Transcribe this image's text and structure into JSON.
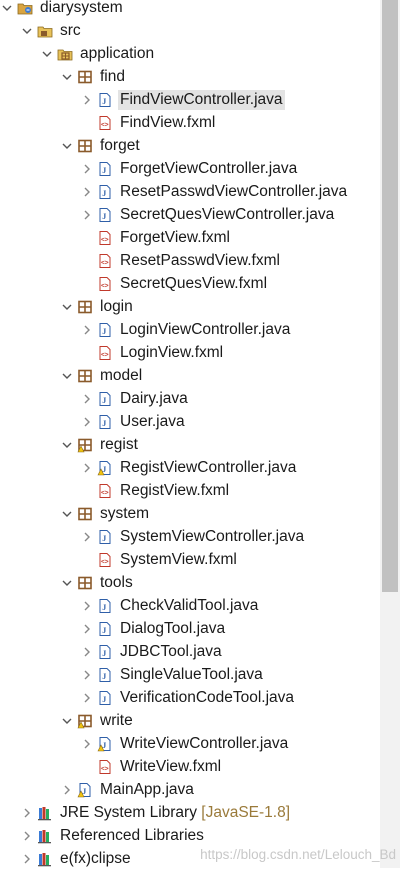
{
  "tree": [
    {
      "label": "diarysystem",
      "depth": 0,
      "toggle": "expanded",
      "icon": "project-icon",
      "name": "tree-item-diarysystem"
    },
    {
      "label": "src",
      "depth": 1,
      "toggle": "expanded",
      "icon": "source-folder-icon",
      "name": "tree-item-src"
    },
    {
      "label": "application",
      "depth": 2,
      "toggle": "expanded",
      "icon": "package-folder-icon",
      "name": "tree-item-application"
    },
    {
      "label": "find",
      "depth": 3,
      "toggle": "expanded",
      "icon": "package-icon",
      "name": "tree-item-find"
    },
    {
      "label": "FindViewController.java",
      "depth": 4,
      "toggle": "collapsed",
      "icon": "java-file-icon",
      "name": "tree-item-findviewcontroller",
      "selected": true
    },
    {
      "label": "FindView.fxml",
      "depth": 4,
      "toggle": "none",
      "icon": "fxml-file-icon",
      "name": "tree-item-findview-fxml"
    },
    {
      "label": "forget",
      "depth": 3,
      "toggle": "expanded",
      "icon": "package-icon",
      "name": "tree-item-forget"
    },
    {
      "label": "ForgetViewController.java",
      "depth": 4,
      "toggle": "collapsed",
      "icon": "java-file-icon",
      "name": "tree-item-forgetviewcontroller"
    },
    {
      "label": "ResetPasswdViewController.java",
      "depth": 4,
      "toggle": "collapsed",
      "icon": "java-file-icon",
      "name": "tree-item-resetpasswdviewcontroller"
    },
    {
      "label": "SecretQuesViewController.java",
      "depth": 4,
      "toggle": "collapsed",
      "icon": "java-file-icon",
      "name": "tree-item-secretquesviewcontroller"
    },
    {
      "label": "ForgetView.fxml",
      "depth": 4,
      "toggle": "none",
      "icon": "fxml-file-icon",
      "name": "tree-item-forgetview-fxml"
    },
    {
      "label": "ResetPasswdView.fxml",
      "depth": 4,
      "toggle": "none",
      "icon": "fxml-file-icon",
      "name": "tree-item-resetpasswdview-fxml"
    },
    {
      "label": "SecretQuesView.fxml",
      "depth": 4,
      "toggle": "none",
      "icon": "fxml-file-icon",
      "name": "tree-item-secretquesview-fxml"
    },
    {
      "label": "login",
      "depth": 3,
      "toggle": "expanded",
      "icon": "package-icon",
      "name": "tree-item-login"
    },
    {
      "label": "LoginViewController.java",
      "depth": 4,
      "toggle": "collapsed",
      "icon": "java-file-icon",
      "name": "tree-item-loginviewcontroller"
    },
    {
      "label": "LoginView.fxml",
      "depth": 4,
      "toggle": "none",
      "icon": "fxml-file-icon",
      "name": "tree-item-loginview-fxml"
    },
    {
      "label": "model",
      "depth": 3,
      "toggle": "expanded",
      "icon": "package-icon",
      "name": "tree-item-model"
    },
    {
      "label": "Dairy.java",
      "depth": 4,
      "toggle": "collapsed",
      "icon": "java-file-icon",
      "name": "tree-item-dairy-java"
    },
    {
      "label": "User.java",
      "depth": 4,
      "toggle": "collapsed",
      "icon": "java-file-icon",
      "name": "tree-item-user-java"
    },
    {
      "label": "regist",
      "depth": 3,
      "toggle": "expanded",
      "icon": "package-warning-icon",
      "name": "tree-item-regist"
    },
    {
      "label": "RegistViewController.java",
      "depth": 4,
      "toggle": "collapsed",
      "icon": "java-file-warning-icon",
      "name": "tree-item-registviewcontroller"
    },
    {
      "label": "RegistView.fxml",
      "depth": 4,
      "toggle": "none",
      "icon": "fxml-file-icon",
      "name": "tree-item-registview-fxml"
    },
    {
      "label": "system",
      "depth": 3,
      "toggle": "expanded",
      "icon": "package-icon",
      "name": "tree-item-system"
    },
    {
      "label": "SystemViewController.java",
      "depth": 4,
      "toggle": "collapsed",
      "icon": "java-file-icon",
      "name": "tree-item-systemviewcontroller"
    },
    {
      "label": "SystemView.fxml",
      "depth": 4,
      "toggle": "none",
      "icon": "fxml-file-icon",
      "name": "tree-item-systemview-fxml"
    },
    {
      "label": "tools",
      "depth": 3,
      "toggle": "expanded",
      "icon": "package-icon",
      "name": "tree-item-tools"
    },
    {
      "label": "CheckValidTool.java",
      "depth": 4,
      "toggle": "collapsed",
      "icon": "java-file-icon",
      "name": "tree-item-checkvalidtool"
    },
    {
      "label": "DialogTool.java",
      "depth": 4,
      "toggle": "collapsed",
      "icon": "java-file-icon",
      "name": "tree-item-dialogtool"
    },
    {
      "label": "JDBCTool.java",
      "depth": 4,
      "toggle": "collapsed",
      "icon": "java-file-icon",
      "name": "tree-item-jdbctool"
    },
    {
      "label": "SingleValueTool.java",
      "depth": 4,
      "toggle": "collapsed",
      "icon": "java-file-icon",
      "name": "tree-item-singlevaluetool"
    },
    {
      "label": "VerificationCodeTool.java",
      "depth": 4,
      "toggle": "collapsed",
      "icon": "java-file-icon",
      "name": "tree-item-verificationcodetool"
    },
    {
      "label": "write",
      "depth": 3,
      "toggle": "expanded",
      "icon": "package-warning-icon",
      "name": "tree-item-write"
    },
    {
      "label": "WriteViewController.java",
      "depth": 4,
      "toggle": "collapsed",
      "icon": "java-file-warning-icon",
      "name": "tree-item-writeviewcontroller"
    },
    {
      "label": "WriteView.fxml",
      "depth": 4,
      "toggle": "none",
      "icon": "fxml-file-icon",
      "name": "tree-item-writeview-fxml"
    },
    {
      "label": "MainApp.java",
      "depth": 3,
      "toggle": "collapsed",
      "icon": "java-file-warning-icon",
      "name": "tree-item-mainapp"
    },
    {
      "label": "JRE System Library",
      "decoration": "[JavaSE-1.8]",
      "depth": 1,
      "toggle": "collapsed",
      "icon": "library-icon",
      "name": "tree-item-jre-system-library"
    },
    {
      "label": "Referenced Libraries",
      "depth": 1,
      "toggle": "collapsed",
      "icon": "library-icon",
      "name": "tree-item-referenced-libraries"
    },
    {
      "label": "e(fx)clipse",
      "depth": 1,
      "toggle": "collapsed",
      "icon": "library-icon",
      "name": "tree-item-efxclipse"
    }
  ],
  "watermark": "https://blog.csdn.net/Lelouch_Bd",
  "colors": {
    "selection": "#e3e3e3",
    "package": "#8a5a2b",
    "java": "#2f5fa8",
    "fxml": "#c0392b",
    "decoration": "#9a7a3a"
  }
}
